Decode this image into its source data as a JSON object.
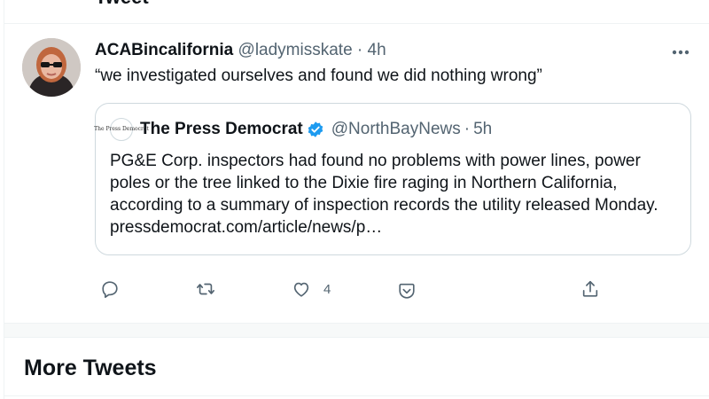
{
  "header": {
    "title": "Tweet"
  },
  "tweet": {
    "display_name": "ACABincalifornia",
    "handle": "@ladymisskate",
    "separator": "·",
    "time": "4h",
    "text": "“we investigated ourselves and found we did nothing wrong”",
    "quote": {
      "logo_text": "The Press Democrat",
      "name": "The Press Democrat",
      "handle": "@NorthBayNews",
      "separator": "·",
      "time": "5h",
      "text": "PG&E Corp. inspectors had found no problems with power lines, power poles or the tree linked to the Dixie fire raging in Northern California, according to a summary of inspection records the utility released Monday.  pressdemocrat.com/article/news/p…"
    },
    "actions": {
      "reply_icon": "reply-icon",
      "retweet_icon": "retweet-icon",
      "like_icon": "like-icon",
      "like_count": "4",
      "revue_icon": "revue-icon",
      "share_icon": "share-icon"
    }
  },
  "section": {
    "more_tweets_label": "More Tweets"
  },
  "colors": {
    "text": "#0f1419",
    "muted": "#536471",
    "verified": "#1d9bf0",
    "border": "#cfd9de"
  }
}
